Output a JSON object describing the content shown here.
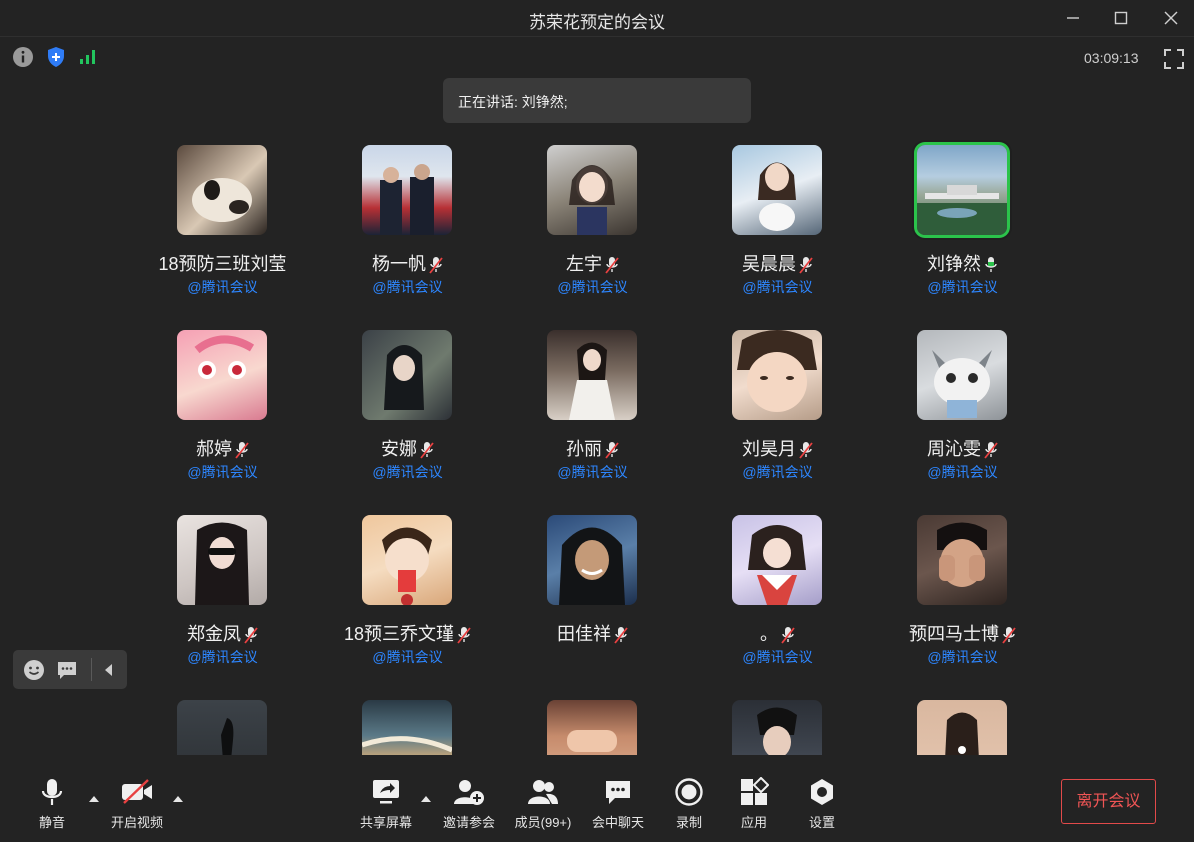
{
  "window": {
    "title": "苏荣花预定的会议"
  },
  "status": {
    "timer": "03:09:13",
    "signal_color": "#22c55e",
    "shield_color": "#2f7cf6"
  },
  "speaking": {
    "text": "正在讲话: 刘铮然;"
  },
  "participants": [
    {
      "name": "18预防三班刘莹",
      "source": "@腾讯会议",
      "mic": "none",
      "active": false
    },
    {
      "name": "杨一帆",
      "source": "@腾讯会议",
      "mic": "muted",
      "active": false
    },
    {
      "name": "左宇",
      "source": "@腾讯会议",
      "mic": "muted",
      "active": false
    },
    {
      "name": "吴晨晨",
      "source": "@腾讯会议",
      "mic": "muted",
      "active": false
    },
    {
      "name": "刘铮然",
      "source": "@腾讯会议",
      "mic": "speaking",
      "active": true
    },
    {
      "name": "郝婷",
      "source": "@腾讯会议",
      "mic": "muted",
      "active": false
    },
    {
      "name": "安娜",
      "source": "@腾讯会议",
      "mic": "muted",
      "active": false
    },
    {
      "name": "孙丽",
      "source": "@腾讯会议",
      "mic": "muted",
      "active": false
    },
    {
      "name": "刘昊月",
      "source": "@腾讯会议",
      "mic": "muted",
      "active": false
    },
    {
      "name": "周沁雯",
      "source": "@腾讯会议",
      "mic": "muted",
      "active": false
    },
    {
      "name": "郑金凤",
      "source": "@腾讯会议",
      "mic": "muted",
      "active": false
    },
    {
      "name": "18预三乔文瑾",
      "source": "@腾讯会议",
      "mic": "muted",
      "active": false
    },
    {
      "name": "田佳祥",
      "source": "",
      "mic": "muted",
      "active": false
    },
    {
      "name": "。",
      "source": "@腾讯会议",
      "mic": "muted",
      "active": false
    },
    {
      "name": "预四马士博",
      "source": "@腾讯会议",
      "mic": "muted",
      "active": false
    },
    {
      "name": "",
      "source": "",
      "mic": "none",
      "active": false
    },
    {
      "name": "",
      "source": "",
      "mic": "none",
      "active": false
    },
    {
      "name": "",
      "source": "",
      "mic": "none",
      "active": false
    },
    {
      "name": "",
      "source": "",
      "mic": "none",
      "active": false
    },
    {
      "name": "",
      "source": "",
      "mic": "none",
      "active": false
    }
  ],
  "toolbar": {
    "mute": "静音",
    "video": "开启视频",
    "share": "共享屏幕",
    "invite": "邀请参会",
    "members": "成员(99+)",
    "chat": "会中聊天",
    "record": "录制",
    "apps": "应用",
    "settings": "设置",
    "leave": "离开会议",
    "leave_color": "#f05555"
  }
}
